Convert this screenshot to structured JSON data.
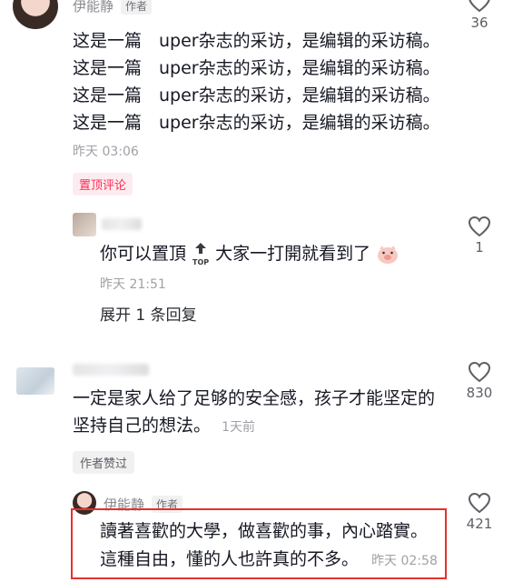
{
  "comment1": {
    "author": "伊能静",
    "author_tag": "作者",
    "lines": [
      "这是一篇  uper杂志的采访，是编辑的采访稿。",
      "这是一篇  uper杂志的采访，是编辑的采访稿。",
      "这是一篇  uper杂志的采访，是编辑的采访稿。",
      "这是一篇  uper杂志的采访，是编辑的采访稿。"
    ],
    "time": "昨天 03:06",
    "pinned_label": "置顶评论",
    "likes": "36"
  },
  "reply1": {
    "text": "你可以置頂",
    "text_after": "大家一打開就看到了",
    "top_icon_label": "TOP",
    "time": "昨天 21:51",
    "likes": "1",
    "expand_label": "展开 1 条回复"
  },
  "comment2": {
    "line1": "一定是家人给了足够的安全感，孩子才能坚定的",
    "line2": "坚持自己的想法。",
    "time": "1天前",
    "author_liked_label": "作者赞过",
    "likes": "830"
  },
  "reply2": {
    "author": "伊能静",
    "author_tag": "作者",
    "line1": "讀著喜歡的大學，做喜歡的事，內心踏實。",
    "line2": "這種自由，懂的人也許真的不多。",
    "time": "昨天 02:58",
    "likes": "421"
  },
  "colors": {
    "accent_red": "#fe2c55",
    "highlight_border": "#e5322d"
  },
  "icons": {
    "like": "heart-outline-icon",
    "top": "pin-top-icon",
    "emoji": "pig-emoji-icon"
  }
}
